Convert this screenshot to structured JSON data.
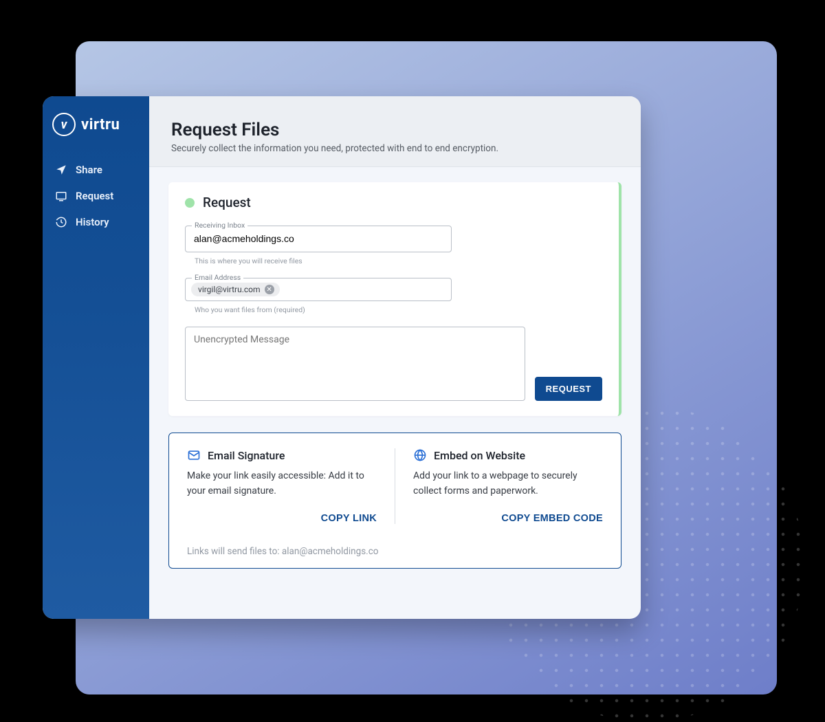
{
  "brand": {
    "name": "virtru",
    "badge_char": "v"
  },
  "sidebar": {
    "items": [
      {
        "label": "Share"
      },
      {
        "label": "Request"
      },
      {
        "label": "History"
      }
    ]
  },
  "header": {
    "title": "Request Files",
    "subtitle": "Securely collect the information you need, protected with end to end encryption."
  },
  "request_card": {
    "title": "Request",
    "receiving_inbox_label": "Receiving Inbox",
    "receiving_inbox_value": "alan@acmeholdings.co",
    "receiving_inbox_helper": "This is where you will receive files",
    "email_address_label": "Email Address",
    "email_chip": "virgil@virtru.com",
    "email_address_helper": "Who you want files from (required)",
    "message_placeholder": "Unencrypted Message",
    "request_button": "REQUEST"
  },
  "share_box": {
    "email_sig": {
      "title": "Email Signature",
      "desc": "Make your link easily accessible: Add it to your email signature.",
      "action": "COPY LINK"
    },
    "embed": {
      "title": "Embed on Website",
      "desc": "Add your link to a webpage to securely collect forms and paperwork.",
      "action": "COPY EMBED CODE"
    },
    "footer": "Links will send files to: alan@acmeholdings.co"
  }
}
